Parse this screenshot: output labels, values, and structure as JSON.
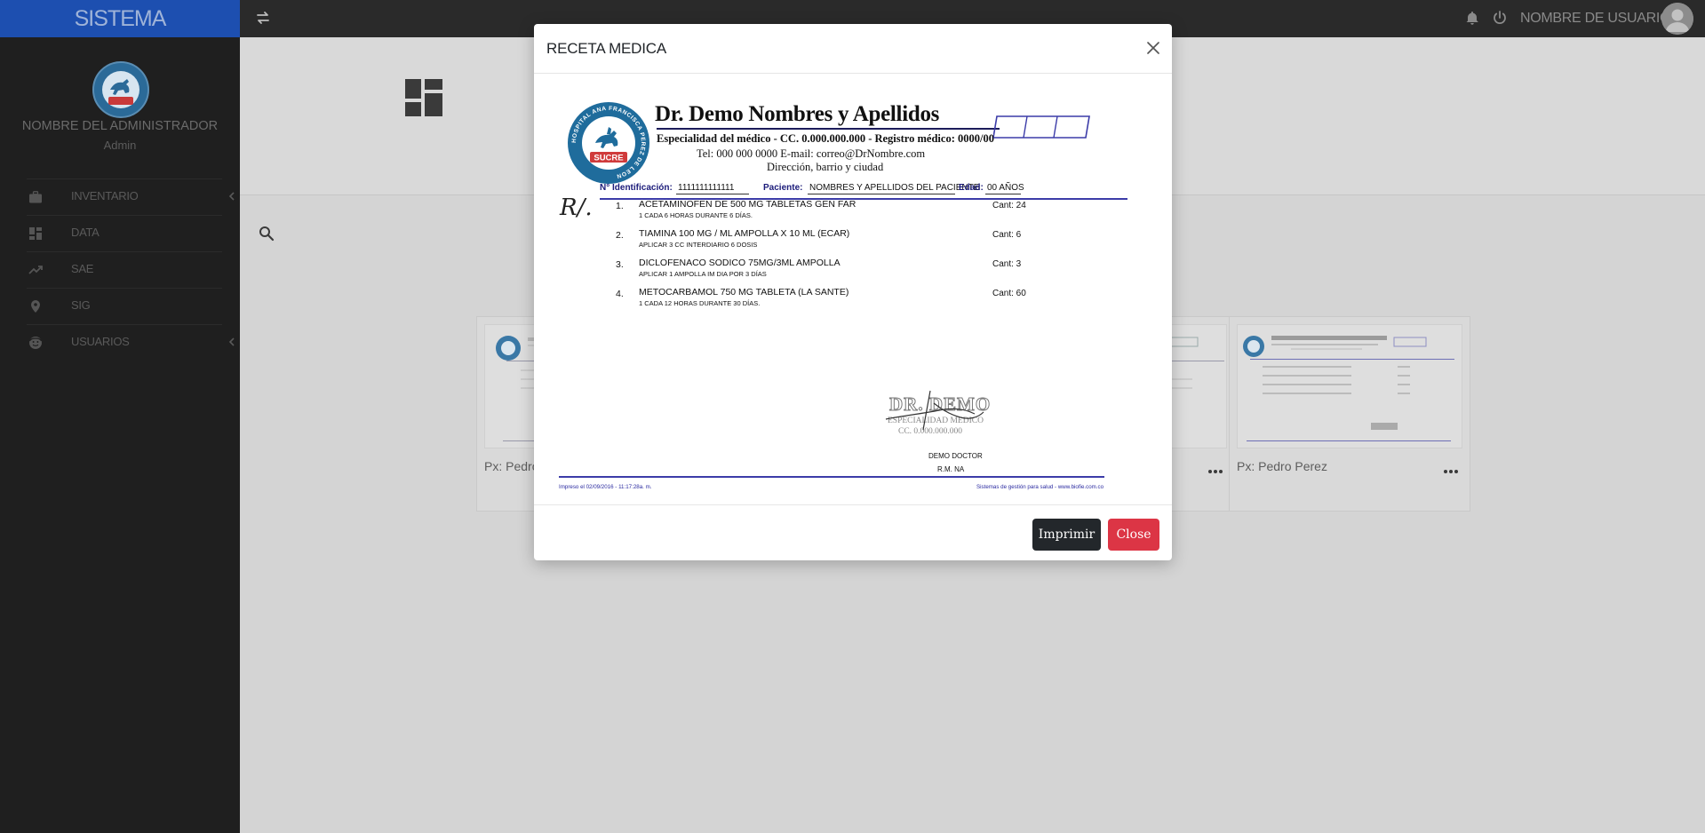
{
  "app": {
    "brand": "SISTEMA",
    "username": "NOMBRE DE USUARIO"
  },
  "sidebar": {
    "admin_name": "NOMBRE DEL ADMINISTRADOR",
    "admin_role": "Admin",
    "logo_text": "SUCRE",
    "items": [
      {
        "label": "INVENTARIO",
        "icon": "briefcase-icon",
        "has_submenu": true
      },
      {
        "label": "DATA",
        "icon": "dashboard-icon",
        "has_submenu": false
      },
      {
        "label": "SAE",
        "icon": "trending-up-icon",
        "has_submenu": false
      },
      {
        "label": "SIG",
        "icon": "map-pin-icon",
        "has_submenu": false
      },
      {
        "label": "USUARIOS",
        "icon": "user-face-icon",
        "has_submenu": true
      }
    ]
  },
  "cards": [
    {
      "label": "Px: Pedro"
    },
    {
      "label": "Px: Pedro Perez"
    }
  ],
  "modal": {
    "title": "RECETA MEDICA",
    "buttons": {
      "print": "Imprimir",
      "close": "Close"
    },
    "document": {
      "seal_text": "SUCRE",
      "seal_ring_text": "HOSPITAL ANA FRANCISCA PEREZ DE LEON",
      "doctor_name": "Dr. Demo Nombres y Apellidos",
      "specialty_line": "Especialidad del médico - CC. 0.000.000.000 - Registro médico: 0000/00",
      "contact_line": "Tel: 000 000 0000 E-mail: correo@DrNombre.com",
      "address_line": "Dirección, barrio y ciudad",
      "id_label": "N° Identificación:",
      "id_value": "1111111111111",
      "patient_label": "Paciente:",
      "patient_value": "NOMBRES Y APELLIDOS DEL PACIENTE",
      "age_label": "Edad:",
      "age_value": "00 AÑOS",
      "rx_symbol": "R/.",
      "items": [
        {
          "num": "1.",
          "drug": "ACETAMINOFEN DE 500 MG TABLETAS GEN FAR",
          "dose": "1 CADA 6 HORAS DURANTE 6 DÍAS.",
          "qty": "Cant: 24"
        },
        {
          "num": "2.",
          "drug": "TIAMINA 100 MG / ML AMPOLLA X 10 ML (ECAR)",
          "dose": "APLICAR 3 CC INTERDIARIO 6 DOSIS",
          "qty": "Cant: 6"
        },
        {
          "num": "3.",
          "drug": "DICLOFENACO SODICO 75MG/3ML AMPOLLA",
          "dose": "APLICAR 1 AMPOLLA IM DIA POR 3 DÍAS",
          "qty": "Cant: 3"
        },
        {
          "num": "4.",
          "drug": "METOCARBAMOL 750 MG TABLETA (LA SANTE)",
          "dose": "1 CADA 12 HORAS DURANTE 30 DÍAS.",
          "qty": "Cant: 60"
        }
      ],
      "stamp_name": "DR. DEMO",
      "stamp_specialty": "ESPECIALIDAD MEDICO",
      "stamp_id": "CC. 0.000.000.000",
      "signer_name": "DEMO DOCTOR",
      "signer_rm": "R.M. NA",
      "printed_at": "Impreso el 02/09/2016 - 11:17:28a. m.",
      "system_credit": "Sistemas  de gestión para salud - www.biofie.com.co"
    }
  },
  "colors": {
    "brand_bar": "#1d4fb0",
    "topbar": "#2a2a2a",
    "sidebar": "#1f1f1f",
    "print_button": "#23272b",
    "close_button": "#dc3545",
    "document_rule": "#3c3ca8"
  }
}
